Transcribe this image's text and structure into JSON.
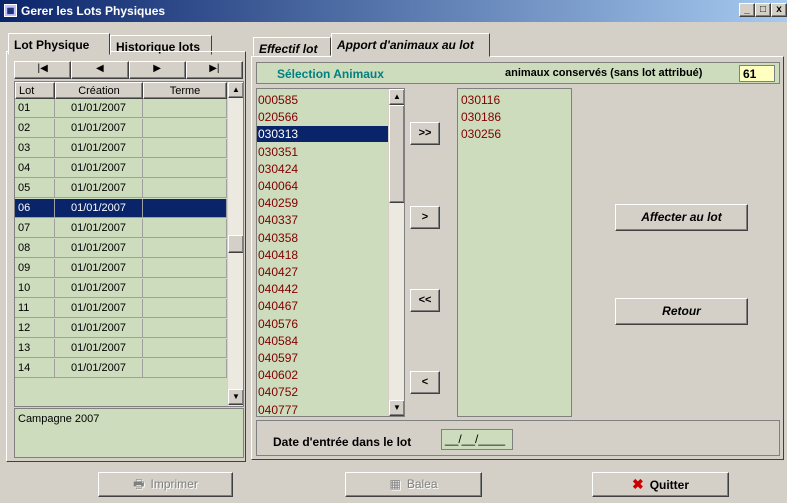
{
  "window": {
    "title": "Gerer les Lots Physiques",
    "controls": {
      "minimize": "_",
      "maximize": "□",
      "close": "x"
    }
  },
  "left_tabs": [
    {
      "label": "Lot Physique",
      "active": true
    },
    {
      "label": "Historique lots",
      "active": false
    }
  ],
  "navigator": {
    "first": "|◀",
    "prev": "◀",
    "next": "▶",
    "last": "▶|"
  },
  "lots_grid": {
    "columns": [
      "Lot",
      "Création",
      "Terme"
    ],
    "rows": [
      {
        "lot": "01",
        "creation": "01/01/2007",
        "terme": ""
      },
      {
        "lot": "02",
        "creation": "01/01/2007",
        "terme": ""
      },
      {
        "lot": "03",
        "creation": "01/01/2007",
        "terme": ""
      },
      {
        "lot": "04",
        "creation": "01/01/2007",
        "terme": ""
      },
      {
        "lot": "05",
        "creation": "01/01/2007",
        "terme": ""
      },
      {
        "lot": "06",
        "creation": "01/01/2007",
        "terme": "",
        "selected": true
      },
      {
        "lot": "07",
        "creation": "01/01/2007",
        "terme": ""
      },
      {
        "lot": "08",
        "creation": "01/01/2007",
        "terme": ""
      },
      {
        "lot": "09",
        "creation": "01/01/2007",
        "terme": ""
      },
      {
        "lot": "10",
        "creation": "01/01/2007",
        "terme": ""
      },
      {
        "lot": "11",
        "creation": "01/01/2007",
        "terme": ""
      },
      {
        "lot": "12",
        "creation": "01/01/2007",
        "terme": ""
      },
      {
        "lot": "13",
        "creation": "01/01/2007",
        "terme": ""
      },
      {
        "lot": "14",
        "creation": "01/01/2007",
        "terme": ""
      }
    ]
  },
  "campagne": "Campagne 2007",
  "right_tabs": [
    {
      "label": "Effectif lot",
      "active": false
    },
    {
      "label": "Apport d'animaux au lot",
      "active": true
    }
  ],
  "selection": {
    "title": "Sélection Animaux",
    "conserved_label": "animaux conservés (sans lot attribué)",
    "conserved_count": "61"
  },
  "available_animals": [
    "000585",
    "020566",
    "030313",
    "030351",
    "030424",
    "040064",
    "040259",
    "040337",
    "040358",
    "040418",
    "040427",
    "040442",
    "040467",
    "040576",
    "040584",
    "040597",
    "040602",
    "040752",
    "040777"
  ],
  "selected_available_index": 2,
  "chosen_animals": [
    "030116",
    "030186",
    "030256"
  ],
  "move_buttons": {
    "add_all": ">>",
    "add_one": ">",
    "remove_all": "<<",
    "remove_one": "<"
  },
  "actions": {
    "assign": "Affecter au lot",
    "back": "Retour"
  },
  "date_entry": {
    "label": "Date d'entrée dans le lot",
    "value": "__/__/____"
  },
  "bottom_buttons": {
    "print": "Imprimer",
    "balea": "Balea",
    "quit": "Quitter"
  },
  "colors": {
    "grid_bg": "#ccdcbc",
    "selection": "#0a246a",
    "animal_text": "#800000",
    "section_title": "#008080",
    "count_bg": "#ffffc0",
    "quit_icon": "#cc0000"
  }
}
